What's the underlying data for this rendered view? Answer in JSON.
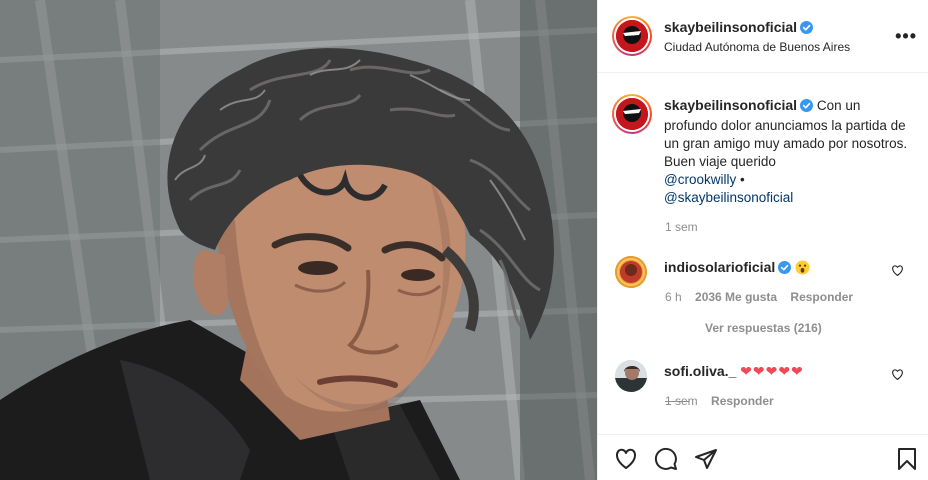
{
  "post": {
    "image_alt": "portrait of a man with curly gray hair"
  },
  "header": {
    "username": "skaybeilinsonoficial",
    "location": "Ciudad Autónoma de Buenos Aires",
    "more_label": "•••"
  },
  "caption": {
    "username": "skaybeilinsonoficial",
    "text": "Con un profundo dolor anunciamos la partida de un gran amigo muy amado por nosotros. Buen viaje querido",
    "mention_1": "@crookwilly",
    "separator": "•",
    "mention_2": "@skaybeilinsonoficial",
    "time": "1 sem"
  },
  "comments": [
    {
      "username": "indiosolarioficial",
      "emoji": "😮",
      "time": "6 h",
      "likes": "2036 Me gusta",
      "reply": "Responder",
      "view_replies": "Ver respuestas (216)"
    },
    {
      "username": "sofi.oliva._",
      "emoji": "❤❤❤❤❤",
      "time": "1 sem",
      "reply": "Responder"
    }
  ],
  "colors": {
    "link": "#00376b",
    "verified": "#3897f0",
    "heart": "#ed4956",
    "muted": "#8e8e8e"
  },
  "icons": [
    "heart-icon",
    "comment-icon",
    "share-icon",
    "bookmark-icon",
    "verified-icon",
    "more-icon"
  ]
}
